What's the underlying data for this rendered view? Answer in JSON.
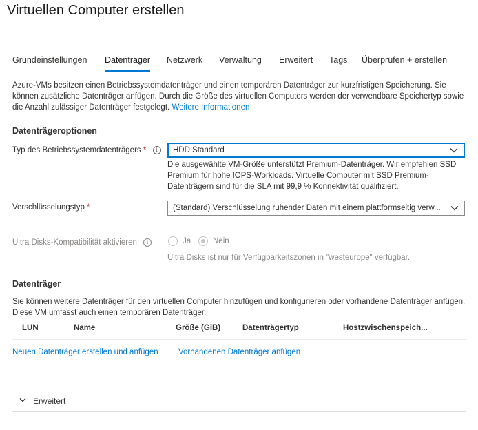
{
  "page": {
    "title": "Virtuellen Computer erstellen"
  },
  "tabs": [
    {
      "label": "Grundeinstellungen"
    },
    {
      "label": "Datenträger"
    },
    {
      "label": "Netzwerk"
    },
    {
      "label": "Verwaltung"
    },
    {
      "label": "Erweitert"
    },
    {
      "label": "Tags"
    },
    {
      "label": "Überprüfen + erstellen"
    }
  ],
  "active_tab": "Datenträger",
  "intro": {
    "text": "Azure-VMs besitzen einen Betriebssystemdatenträger und einen temporären Datenträger zur kurzfristigen Speicherung. Sie können zusätzliche Datenträger anfügen. Durch die Größe des virtuellen Computers werden der verwendbare Speichertyp sowie die Anzahl zulässiger Datenträger festgelegt.",
    "link": "Weitere Informationen"
  },
  "disk_options": {
    "heading": "Datenträgeroptionen",
    "os_disk_type": {
      "label": "Typ des Betriebssystemdatenträgers",
      "required_mark": "*",
      "info_icon": "i",
      "value": "HDD Standard",
      "help": "Die ausgewählte VM-Größe unterstützt Premium-Datenträger. Wir empfehlen SSD Premium für hohe IOPS-Workloads. Virtuelle Computer mit SSD Premium-Datenträgern sind für die SLA mit 99,9 % Konnektivität qualifiziert."
    },
    "encryption_type": {
      "label": "Verschlüsselungstyp",
      "required_mark": "*",
      "value": "(Standard) Verschlüsselung ruhender Daten mit einem plattformseitig verw..."
    },
    "ultra_disks": {
      "label": "Ultra Disks-Kompatibilität aktivieren",
      "info_icon": "i",
      "options": [
        {
          "label": "Ja",
          "checked": false
        },
        {
          "label": "Nein",
          "checked": true
        }
      ],
      "help": "Ultra Disks ist nur für Verfügbarkeitszonen in \"westeurope\" verfügbar."
    }
  },
  "data_disks": {
    "heading": "Datenträger",
    "description": "Sie können weitere Datenträger für den virtuellen Computer hinzufügen und konfigurieren oder vorhandene Datenträger anfügen. Diese VM umfasst auch einen temporären Datenträger.",
    "columns": [
      "LUN",
      "Name",
      "Größe (GiB)",
      "Datenträgertyp",
      "Hostzwischenspeich..."
    ],
    "rows": [],
    "create_link": "Neuen Datenträger erstellen und anfügen",
    "attach_link": "Vorhandenen Datenträger anfügen"
  },
  "advanced": {
    "label": "Erweitert",
    "expanded": false
  },
  "colors": {
    "accent": "#0078d4",
    "required": "#a4262c",
    "disabled": "#8a8886"
  },
  "icons": {
    "dropdown": "chevron-down-icon",
    "info": "info-icon",
    "expander": "chevron-down-icon"
  }
}
